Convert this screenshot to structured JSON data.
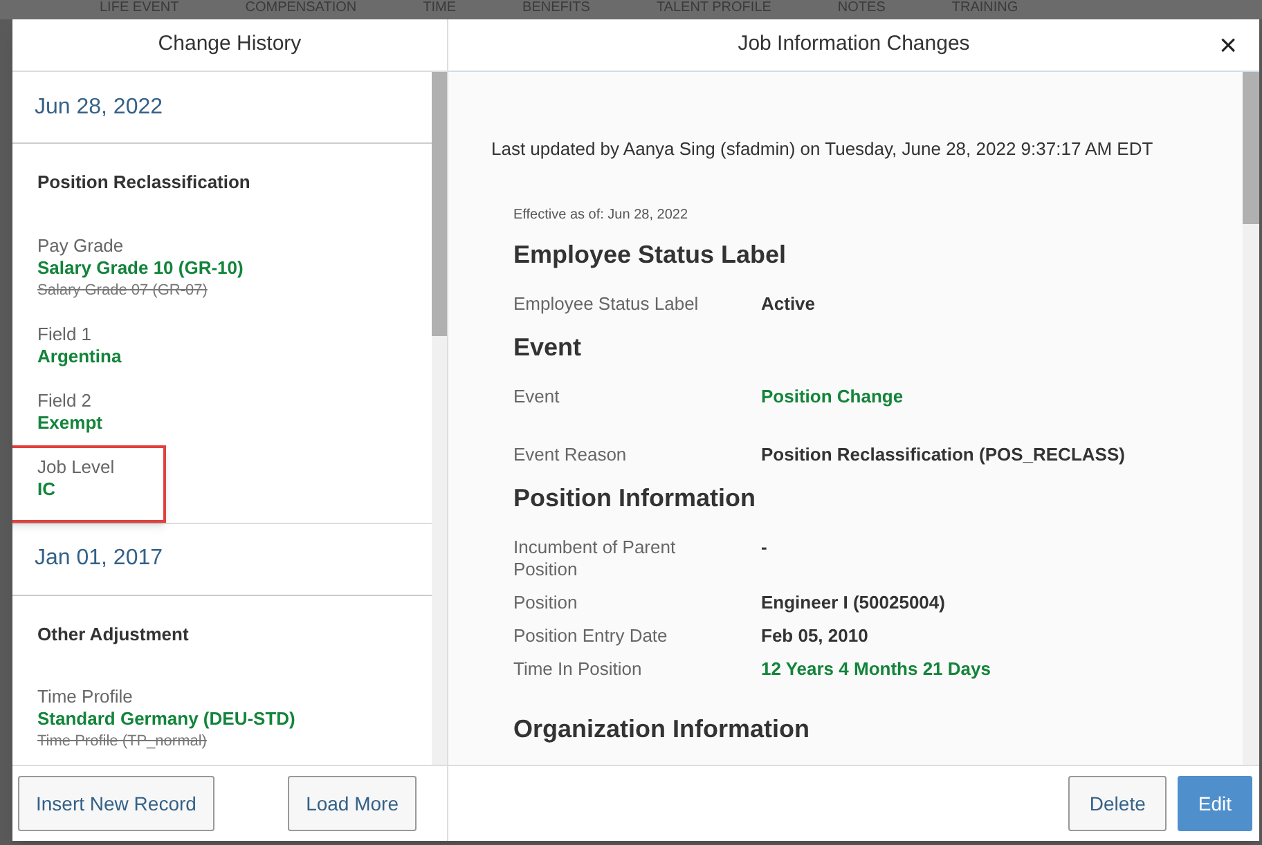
{
  "background_nav": [
    "LIFE EVENT",
    "COMPENSATION",
    "TIME",
    "BENEFITS",
    "TALENT PROFILE",
    "NOTES",
    "TRAINING"
  ],
  "history": {
    "title": "Change History",
    "entries": [
      {
        "date": "Jun 28, 2022",
        "title": "Position Reclassification",
        "changes": [
          {
            "label": "Pay Grade",
            "new": "Salary Grade 10 (GR-10)",
            "old": "Salary Grade 07 (GR-07)",
            "highlighted": false
          },
          {
            "label": "Field 1",
            "new": "Argentina",
            "highlighted": false
          },
          {
            "label": "Field 2",
            "new": "Exempt",
            "highlighted": false
          },
          {
            "label": "Job Level",
            "new": "IC",
            "highlighted": true
          }
        ]
      },
      {
        "date": "Jan 01, 2017",
        "title": "Other Adjustment",
        "changes": [
          {
            "label": "Time Profile",
            "new": "Standard Germany (DEU-STD)",
            "old": "Time Profile (TP_normal)",
            "highlighted": false
          }
        ]
      }
    ],
    "buttons": [
      "Insert New Record",
      "Load More"
    ]
  },
  "details": {
    "title": "Job Information Changes",
    "close": "×",
    "last_updated": "Last updated by Aanya Sing (sfadmin) on Tuesday, June 28, 2022 9:37:17 AM EDT",
    "effective": "Effective as of: Jun 28, 2022",
    "sections": [
      {
        "heading": "Employee Status Label",
        "fields": [
          {
            "label": "Employee Status Label",
            "value": "Active",
            "changed": false
          }
        ]
      },
      {
        "heading": "Event",
        "fields": [
          {
            "label": "Event",
            "value": "Position Change",
            "changed": true
          },
          {
            "label": "Event Reason",
            "value": "Position Reclassification (POS_RECLASS)",
            "changed": false
          }
        ]
      },
      {
        "heading": "Position Information",
        "fields": [
          {
            "label": "Incumbent of Parent Position",
            "value": "-",
            "changed": false
          },
          {
            "label": "Position",
            "value": "Engineer I (50025004)",
            "changed": false
          },
          {
            "label": "Position Entry Date",
            "value": "Feb 05, 2010",
            "changed": false
          },
          {
            "label": "Time In Position",
            "value": "12 Years 4 Months 21 Days",
            "changed": true
          }
        ]
      },
      {
        "heading": "Organization Information"
      }
    ],
    "buttons": [
      {
        "label": "Delete",
        "kind": "secondary"
      },
      {
        "label": "Edit",
        "kind": "primary"
      }
    ]
  }
}
